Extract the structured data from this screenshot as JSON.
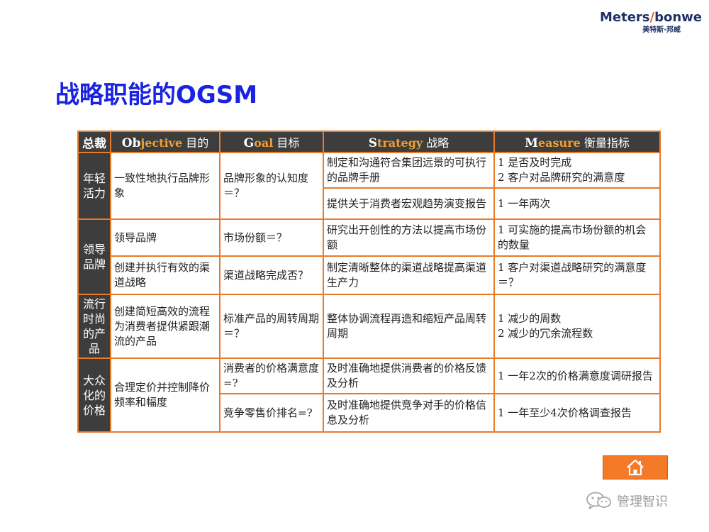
{
  "logo": {
    "main_a": "Meters",
    "main_slash": "/",
    "main_b": "bonwe",
    "sub": "美特斯·邦威"
  },
  "title": "战略职能的OGSM",
  "table": {
    "headers": [
      {
        "prefix": "总裁",
        "rest": ""
      },
      {
        "prefix": "Ob",
        "en": "jective",
        "rest": " 目的"
      },
      {
        "prefix": "G",
        "en": "oal",
        "rest": " 目标"
      },
      {
        "prefix": "S",
        "en": "trategy",
        "rest": " 战略"
      },
      {
        "prefix": "M",
        "en": "easure",
        "rest": " 衡量指标"
      }
    ],
    "categories": [
      "年轻活力",
      "领导品牌",
      "流行时尚的产品",
      "大众化的价格"
    ],
    "rows": [
      {
        "objective": "一致性地执行品牌形象",
        "goal": "品牌形象的认知度＝？",
        "strategy": "制定和沟通符合集团远景的可执行的品牌手册",
        "measure": "1 是否及时完成\n2 客户对品牌研究的满意度"
      },
      {
        "strategy": "提供关于消费者宏观趋势演变报告",
        "measure": "1 一年两次"
      },
      {
        "objective": "领导品牌",
        "goal": "市场份额＝？",
        "strategy": "研究出开创性的方法以提高市场份额",
        "measure": "1 可实施的提高市场份额的机会的数量"
      },
      {
        "objective": "创建并执行有效的渠道战略",
        "goal": "渠道战略完成否？",
        "strategy": "制定清晰整体的渠道战略提高渠道生产力",
        "measure": "1 客户对渠道战略研究的满意度＝？"
      },
      {
        "objective": "创建简短高效的流程为消费者提供紧跟潮流的产品",
        "goal": "标准产品的周转周期＝？",
        "strategy": "整体协调流程再造和缩短产品周转周期",
        "measure": "1 减少的周数\n2 减少的冗余流程数"
      },
      {
        "objective": "合理定价并控制降价频率和幅度",
        "goal": "消费者的价格满意度=?",
        "strategy": "及时准确地提供消费者的价格反馈及分析",
        "measure": "1 一年2次的价格满意度调研报告"
      },
      {
        "goal": "竞争零售价排名=?",
        "strategy": "及时准确地提供竞争对手的价格信息及分析",
        "measure": "1 一年至少4次价格调查报告"
      }
    ]
  },
  "watermark": "管理智识",
  "colors": {
    "title": "#1a23e0",
    "border": "#e87a2a",
    "header_bg": "#3d3d3d",
    "button": "#f47a28"
  },
  "icons": {
    "home": "home-icon",
    "wechat": "wechat-icon"
  }
}
